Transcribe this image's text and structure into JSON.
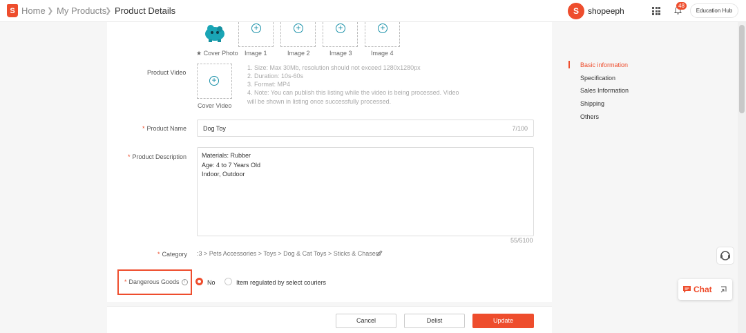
{
  "header": {
    "breadcrumbs": [
      "Home",
      "My Products",
      "Product Details"
    ],
    "shop_name": "shopeeph",
    "notification_count": "48",
    "education_hub": "Education Hub"
  },
  "media": {
    "images": [
      "Cover Photo",
      "Image 1",
      "Image 2",
      "Image 3",
      "Image 4"
    ],
    "video_label": "Product Video",
    "video_caption": "Cover Video",
    "video_notes": [
      "1. Size: Max 30Mb, resolution should not exceed 1280x1280px",
      "2. Duration: 10s-60s",
      "3. Format: MP4",
      "4. Note: You can publish this listing while the video is being processed. Video",
      "will be shown in listing once successfully processed."
    ]
  },
  "form": {
    "product_name_label": "Product Name",
    "product_name_value": "Dog Toy",
    "product_name_count": "7/100",
    "description_label": "Product Description",
    "description_lines": [
      "Materials: Rubber",
      "Age: 4 to 7 Years Old",
      "Indoor, Outdoor"
    ],
    "description_count": "55/5100",
    "category_label": "Category",
    "category_value": ":3 > Pets Accessories > Toys > Dog & Cat Toys > Sticks & Chasers",
    "dangerous_goods_label": "Dangerous Goods",
    "dangerous_options": [
      "No",
      "Item regulated by select couriers"
    ],
    "dangerous_selected": "No"
  },
  "footer": {
    "cancel": "Cancel",
    "delist": "Delist",
    "update": "Update"
  },
  "sidenav": {
    "items": [
      "Basic information",
      "Specification",
      "Sales Information",
      "Shipping",
      "Others"
    ],
    "active": "Basic information"
  },
  "chat": {
    "label": "Chat"
  },
  "colors": {
    "accent": "#ee4d2d",
    "link": "#1890a8"
  }
}
